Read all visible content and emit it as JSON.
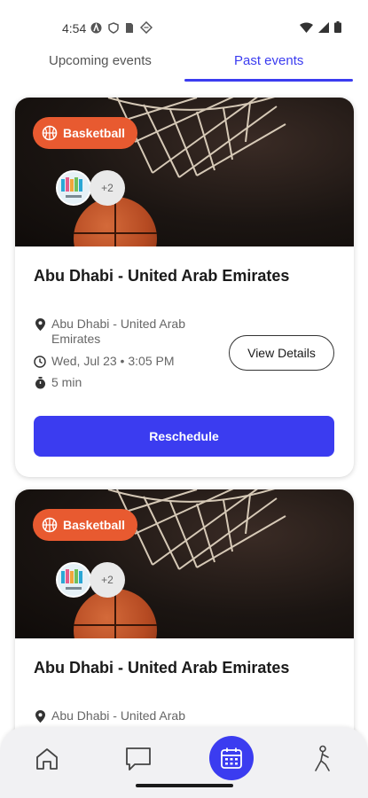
{
  "status_bar": {
    "time": "4:54",
    "icons": [
      "a-badge-icon",
      "shield-icon",
      "sim-icon",
      "diamond-icon",
      "wifi-icon",
      "signal-icon",
      "battery-icon"
    ]
  },
  "tabs": [
    {
      "label": "Upcoming events",
      "selected": false
    },
    {
      "label": "Past events",
      "selected": true
    }
  ],
  "accent_color": "#3b3cf0",
  "badge_color": "#e85a30",
  "events": [
    {
      "sport": "Basketball",
      "participants_more": "+2",
      "title": "Abu Dhabi - United Arab Emirates",
      "location": "Abu Dhabi - United Arab Emirates",
      "datetime": "Wed, Jul 23 • 3:05 PM",
      "duration": "5 min",
      "details_label": "View Details",
      "action_label": "Reschedule"
    },
    {
      "sport": "Basketball",
      "participants_more": "+2",
      "title": "Abu Dhabi - United Arab Emirates",
      "location": "Abu Dhabi - United Arab"
    }
  ],
  "bottom_nav": [
    {
      "icon": "home-icon",
      "active": false
    },
    {
      "icon": "chat-icon",
      "active": false
    },
    {
      "icon": "calendar-icon",
      "active": true
    },
    {
      "icon": "person-icon",
      "active": false
    }
  ]
}
